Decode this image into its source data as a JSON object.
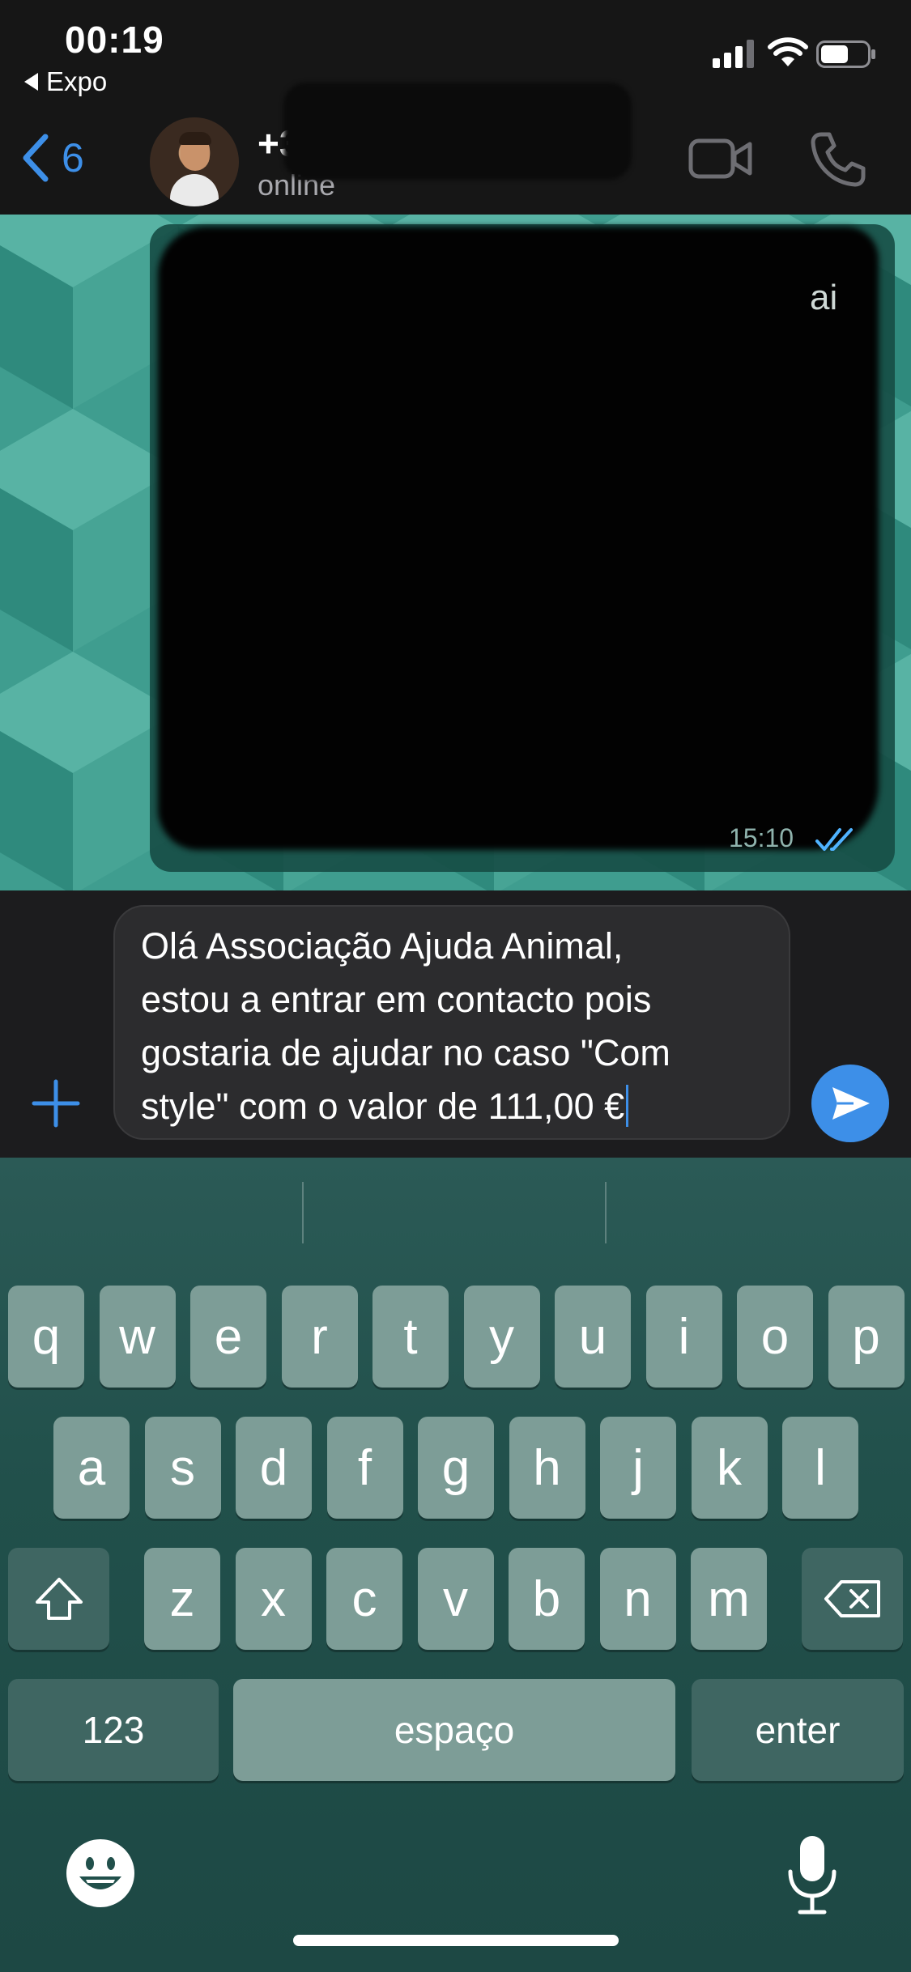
{
  "status_bar": {
    "time": "00:19",
    "back_app": "Expo",
    "battery_level": 0.6
  },
  "header": {
    "back_count": "6",
    "contact_name": "+351",
    "contact_status": "online"
  },
  "conversation": {
    "peek_text": "ai",
    "message_time": "15:10",
    "read_state": "read"
  },
  "composer": {
    "message_text": "Olá Associação Ajuda Animal,\nestou a entrar em contacto pois\ngostaria de ajudar no caso \"Com\nstyle\" com o valor de 111,00 €"
  },
  "keyboard": {
    "row1": [
      "q",
      "w",
      "e",
      "r",
      "t",
      "y",
      "u",
      "i",
      "o",
      "p"
    ],
    "row2": [
      "a",
      "s",
      "d",
      "f",
      "g",
      "h",
      "j",
      "k",
      "l"
    ],
    "row3": [
      "z",
      "x",
      "c",
      "v",
      "b",
      "n",
      "m"
    ],
    "numbers_label": "123",
    "space_label": "espaço",
    "enter_label": "enter"
  },
  "colors": {
    "accent": "#3d8fe8",
    "wallpaper": "#3f9d8f",
    "key": "#7d9d97",
    "key_dark": "#3f6662"
  }
}
